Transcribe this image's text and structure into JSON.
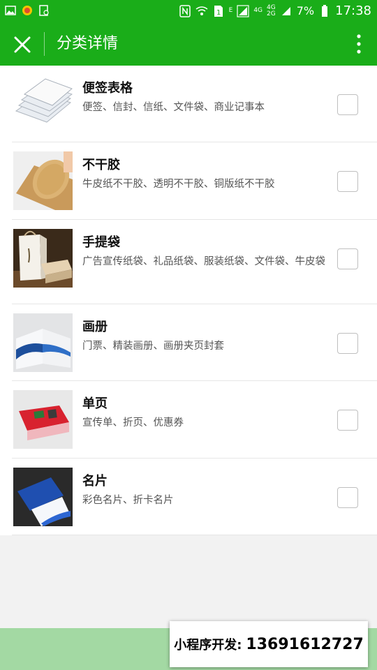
{
  "statusbar": {
    "time": "17:38",
    "battery_pct": "7%",
    "net_e": "E",
    "net_4g": "4G",
    "net_4g_2": "4G",
    "net_2g": "2G"
  },
  "header": {
    "title": "分类详情"
  },
  "categories": [
    {
      "name": "便签表格",
      "desc": "便签、信封、信纸、文件袋、商业记事本",
      "checked": false,
      "icon": "stationery-image"
    },
    {
      "name": "不干胶",
      "desc": "牛皮纸不干胶、透明不干胶、铜版纸不干胶",
      "checked": false,
      "icon": "sticker-image"
    },
    {
      "name": "手提袋",
      "desc": "广告宣传纸袋、礼品纸袋、服装纸袋、文件袋、牛皮袋",
      "checked": false,
      "icon": "paper-bag-image"
    },
    {
      "name": "画册",
      "desc": "门票、精装画册、画册夹页封套",
      "checked": false,
      "icon": "brochure-image"
    },
    {
      "name": "单页",
      "desc": "宣传单、折页、优惠券",
      "checked": false,
      "icon": "flyer-image"
    },
    {
      "name": "名片",
      "desc": "彩色名片、折卡名片",
      "checked": false,
      "icon": "business-card-image"
    }
  ],
  "promo": {
    "label": "小程序开发:",
    "phone": "13691612727"
  }
}
